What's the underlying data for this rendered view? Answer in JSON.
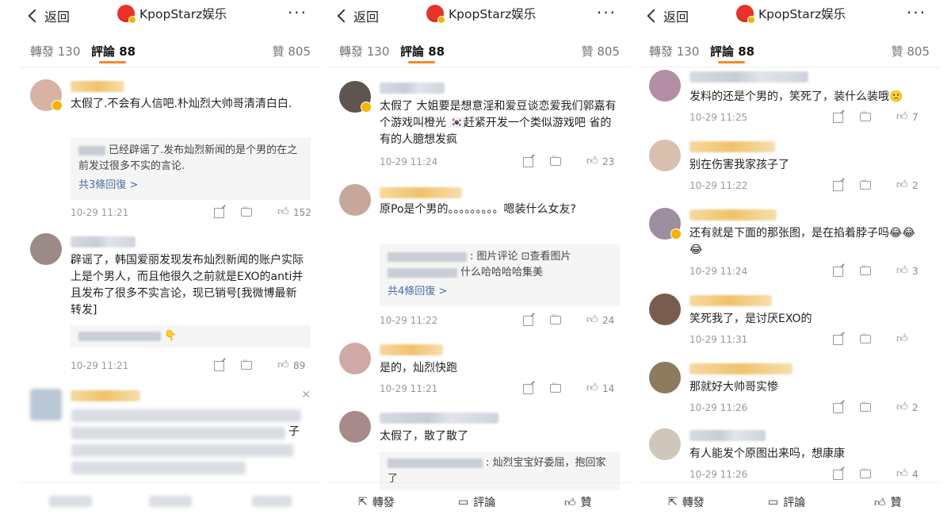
{
  "header": {
    "back_label": "返回",
    "account_name": "KpopStarz娱乐",
    "more_icon": "···"
  },
  "tabs": {
    "reposts": "轉發 130",
    "comments": "評論 88",
    "likes": "贊 805"
  },
  "footer": {
    "repost": "轉發",
    "comment": "評論",
    "like": "贊"
  },
  "panel1": {
    "comments": [
      {
        "text": "太假了.不会有人信吧.朴灿烈大帅哥清清白白.",
        "reply": "已经辟谣了.发布灿烈新闻的是个男的在之前发过很多不实的言论.",
        "reply_more": "共3條回復 >",
        "time": "10-29 11:21",
        "likes": "152"
      },
      {
        "text": "辟谣了，韩国爱丽发现发布灿烈新闻的账户实际上是个男人，而且他很久之前就是EXO的anti并且发布了很多不实言论，现已销号[我微博最新转发]",
        "reply": "👇",
        "time": "10-29 11:21",
        "likes": "89"
      },
      {
        "text": "子"
      }
    ]
  },
  "panel2": {
    "comments": [
      {
        "text": "太假了 大姐要是想意淫和爱豆谈恋爱我们郭嘉有个游戏叫橙光 🇰🇷赶紧开发一个类似游戏吧 省的有的人臆想发疯",
        "time": "10-29 11:24",
        "likes": "23"
      },
      {
        "text": "原Po是个男的。。。。。。。。。嗯装什么女友?",
        "reply1": ": 图片评论 ⊡查看图片",
        "reply2": "什么哈哈哈哈集美",
        "reply_more": "共4條回復 >",
        "time": "10-29 11:22",
        "likes": "24"
      },
      {
        "text": "是的，灿烈快跑",
        "time": "10-29 11:21",
        "likes": "14"
      },
      {
        "text": "太假了，散了散了",
        "reply": ": 灿烈宝宝好委屈，抱回家了"
      }
    ]
  },
  "panel3": {
    "comments": [
      {
        "text": "发料的还是个男的，笑死了，装什么装哦🙁",
        "time": "10-29 11:25",
        "likes": "7"
      },
      {
        "text": "别在伤害我家孩子了",
        "time": "10-29 11:22",
        "likes": "2"
      },
      {
        "text": "还有就是下面的那张图，是在掐着脖子吗😂😂😂",
        "time": "10-29 11:24",
        "likes": "3"
      },
      {
        "text": "笑死我了，是讨厌EXO的",
        "time": "10-29 11:31",
        "likes": ""
      },
      {
        "text": "那就好大帅哥实惨",
        "time": "10-29 11:26",
        "likes": "2"
      },
      {
        "text": "有人能发个原图出来吗，想康康",
        "time": "10-29 11:26",
        "likes": "4"
      }
    ]
  }
}
